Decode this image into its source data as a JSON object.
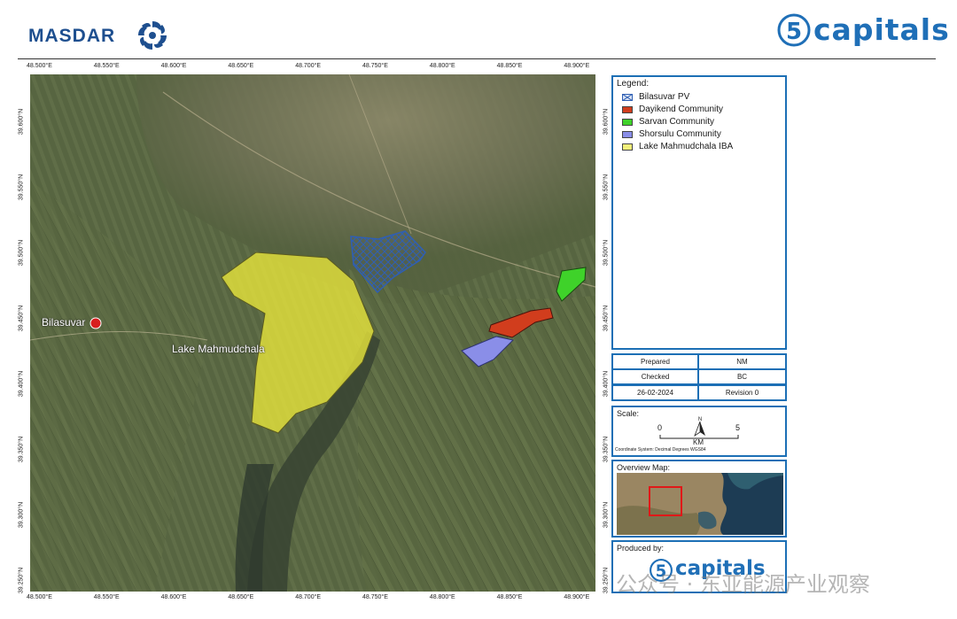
{
  "header": {
    "left_logo_text": "MASDAR",
    "right_logo_text": "capitals",
    "right_logo_numeral": "5"
  },
  "map": {
    "x_ticks_top": [
      "48.500°E",
      "48.550°E",
      "48.600°E",
      "48.650°E",
      "48.700°E",
      "48.750°E",
      "48.800°E",
      "48.850°E",
      "48.900°E"
    ],
    "x_ticks_bottom": [
      "48.500°E",
      "48.550°E",
      "48.600°E",
      "48.650°E",
      "48.700°E",
      "48.750°E",
      "48.800°E",
      "48.850°E",
      "48.900°E"
    ],
    "y_ticks_left": [
      "39.600°N",
      "39.550°N",
      "39.500°N",
      "39.450°N",
      "39.400°N",
      "39.350°N",
      "39.300°N",
      "39.250°N"
    ],
    "y_ticks_right": [
      "39.600°N",
      "39.550°N",
      "39.500°N",
      "39.450°N",
      "39.400°N",
      "39.350°N",
      "39.300°N",
      "39.250°N"
    ],
    "places": {
      "town": "Bilasuvar",
      "lake": "Lake Mahmudchala"
    },
    "colors": {
      "pv": "#2f5fb3",
      "dayikend": "#d13d1d",
      "sarvan": "#3fd22a",
      "shorsulu": "#8a8ee8",
      "iba": "#e4e23c",
      "town_marker": "#d81e1e"
    }
  },
  "legend": {
    "title": "Legend:",
    "items": [
      {
        "label": "Bilasuvar PV",
        "color": "#2f5fb3",
        "pattern": "hatch"
      },
      {
        "label": "Dayikend Community",
        "color": "#d13d1d"
      },
      {
        "label": "Sarvan Community",
        "color": "#3fd22a"
      },
      {
        "label": "Shorsulu Community",
        "color": "#8a8ee8"
      },
      {
        "label": "Lake Mahmudchala IBA",
        "color": "#f3f07a"
      }
    ]
  },
  "info": {
    "prepared_label": "Prepared",
    "prepared_value": "NM",
    "checked_label": "Checked",
    "checked_value": "BC",
    "date": "26-02-2024",
    "revision": "Revision 0"
  },
  "scale": {
    "title": "Scale:",
    "start": "0",
    "end": "5",
    "unit": "KM",
    "north": "N",
    "coord_system": "Coordinate System: Decimal Degrees WGS84"
  },
  "overview": {
    "title": "Overview Map:"
  },
  "producer": {
    "title": "Produced by:",
    "logo_text": "capitals",
    "logo_numeral": "5"
  },
  "watermark": "公众号 · 东亚能源产业观察"
}
